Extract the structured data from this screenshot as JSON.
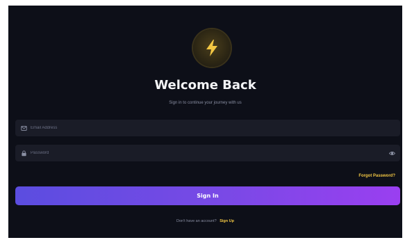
{
  "header": {
    "logo_icon": "lightning-bolt-icon",
    "title": "Welcome Back",
    "subtitle": "Sign in to continue your journey with us"
  },
  "form": {
    "email": {
      "icon": "envelope-icon",
      "placeholder": "Email Address",
      "value": ""
    },
    "password": {
      "icon": "lock-icon",
      "placeholder": "Password",
      "value": "",
      "toggle_icon": "eye-icon"
    },
    "forgot_label": "Forgot Password?",
    "submit_label": "Sign In"
  },
  "footer": {
    "prompt": "Don't have an account?",
    "signup_label": "Sign Up"
  },
  "colors": {
    "background": "#0d0f18",
    "field": "#1a1c27",
    "accent": "#f3c743",
    "gradient_start": "#5b4de0",
    "gradient_end": "#9a3ff0"
  }
}
